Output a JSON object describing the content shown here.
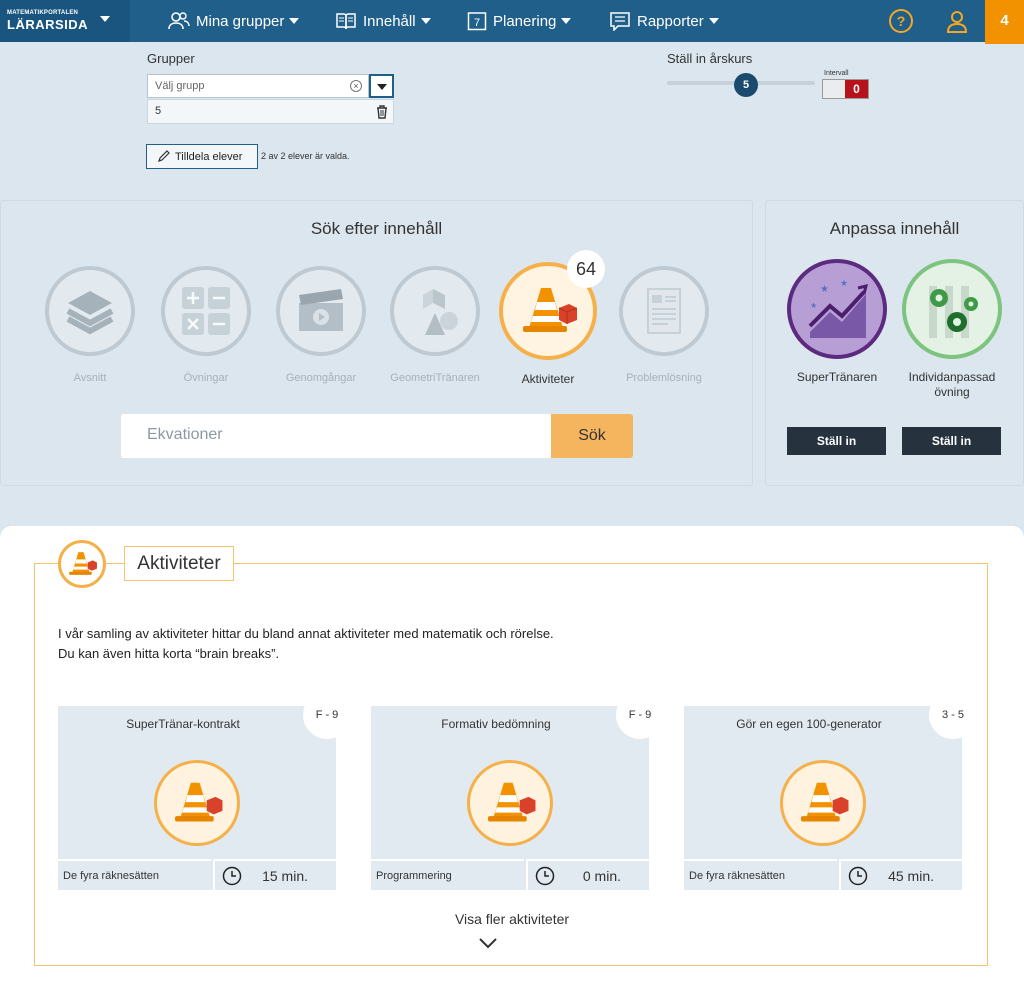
{
  "brand": {
    "small": "MATEMATIKPORTALEN",
    "big": "LÄRARSIDA"
  },
  "nav": [
    {
      "label": "Mina grupper",
      "icon": "users-icon"
    },
    {
      "label": "Innehåll",
      "icon": "book-icon"
    },
    {
      "label": "Planering",
      "icon": "calendar-icon",
      "calendar_day": "7"
    },
    {
      "label": "Rapporter",
      "icon": "report-icon"
    }
  ],
  "help_label": "?",
  "notification_count": "4",
  "groups": {
    "label": "Grupper",
    "placeholder": "Välj grupp",
    "clear_label": "×",
    "selected": "5",
    "assign_label": "Tilldela elever",
    "assign_info": "2 av 2 elever är valda."
  },
  "grade": {
    "label": "Ställ in årskurs",
    "value": "5",
    "interval_label": "Intervall",
    "interval_value": "0"
  },
  "search": {
    "title": "Sök efter innehåll",
    "types": [
      "Avsnitt",
      "Övningar",
      "Genomgångar",
      "GeometriTränaren",
      "Aktiviteter",
      "Problemlösning"
    ],
    "active_type": "Aktiviteter",
    "count": "64",
    "query": "Ekvationer",
    "button": "Sök"
  },
  "customize": {
    "title": "Anpassa innehåll",
    "items": [
      {
        "label": "SuperTränaren",
        "button": "Ställ in"
      },
      {
        "label": "Individanpassad övning",
        "button": "Ställ in"
      }
    ]
  },
  "activities": {
    "title": "Aktiviteter",
    "description": "I vår samling av aktiviteter hittar du bland annat aktiviteter med matematik och rörelse. Du kan även hitta korta “brain breaks”.",
    "cards": [
      {
        "title": "SuperTränar-kontrakt",
        "grade": "F - 9",
        "category": "De fyra räknesätten",
        "time": "15 min."
      },
      {
        "title": "Formativ bedömning",
        "grade": "F - 9",
        "category": "Programmering",
        "time": "0 min."
      },
      {
        "title": "Gör en egen 100-generator",
        "grade": "3 - 5",
        "category": "De fyra räknesätten",
        "time": "45 min."
      }
    ],
    "more": "Visa fler aktiviteter"
  },
  "colors": {
    "nav": "#1f5f8a",
    "accent": "#f39200",
    "activity": "#f5b04a",
    "panel": "#dbe6ee",
    "dark_button": "#26323d",
    "toggle_on": "#b5121b"
  }
}
